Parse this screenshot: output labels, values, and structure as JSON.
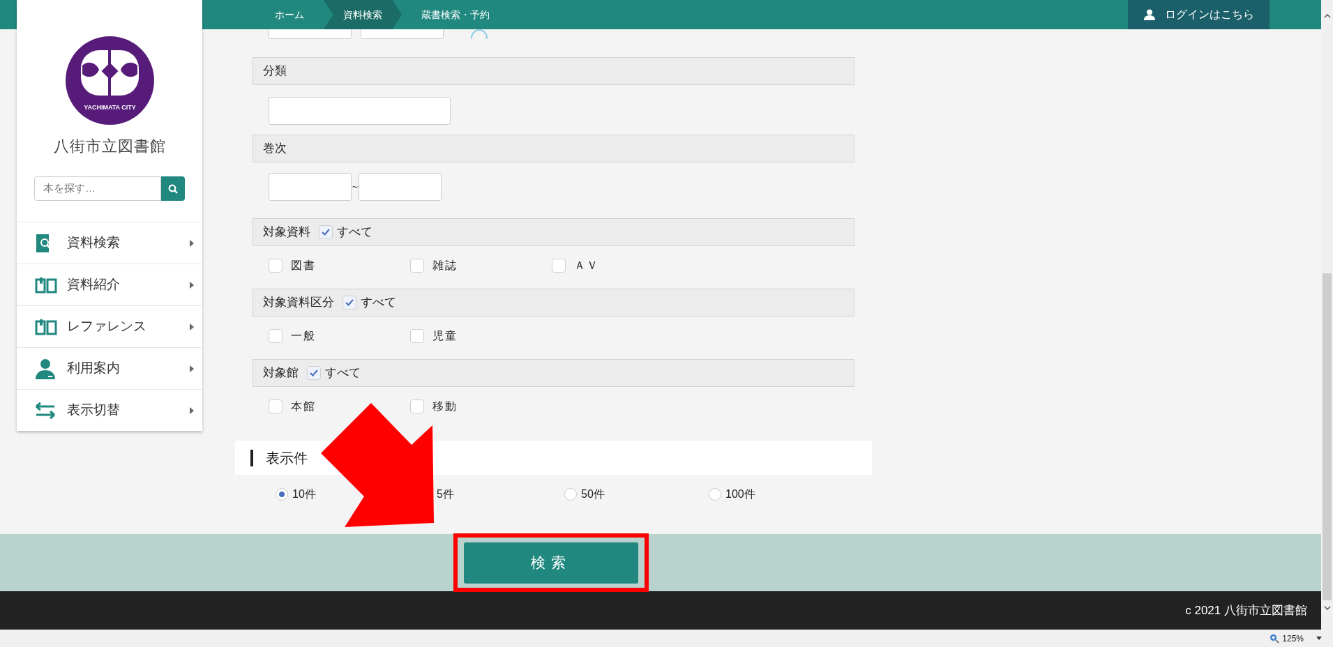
{
  "breadcrumb": [
    {
      "label": "ホーム",
      "selected": false
    },
    {
      "label": "資料検索",
      "selected": true
    },
    {
      "label": "蔵書検索・予約",
      "selected": false
    }
  ],
  "login_button": "ログインはこちら",
  "sidebar": {
    "logo_text": "YACHIMATA CITY",
    "library_name": "八街市立図書館",
    "search": {
      "placeholder": "本を探す…"
    },
    "items": [
      {
        "label": "資料検索",
        "kind": "search"
      },
      {
        "label": "資料紹介",
        "kind": "book"
      },
      {
        "label": "レファレンス",
        "kind": "book"
      },
      {
        "label": "利用案内",
        "kind": "person"
      },
      {
        "label": "表示切替",
        "kind": "swap"
      }
    ]
  },
  "form": [
    {
      "kind": "text",
      "label": "分類"
    },
    {
      "kind": "range",
      "label": "巻次",
      "separator": "~"
    },
    {
      "kind": "checks",
      "label": "対象資料",
      "all_label": "すべて",
      "all_checked": true,
      "options": [
        {
          "label": "図書",
          "checked": false
        },
        {
          "label": "雑誌",
          "checked": false
        },
        {
          "label": "ＡＶ",
          "checked": false
        }
      ]
    },
    {
      "kind": "checks",
      "label": "対象資料区分",
      "all_label": "すべて",
      "all_checked": true,
      "options": [
        {
          "label": "一般",
          "checked": false
        },
        {
          "label": "児童",
          "checked": false
        }
      ]
    },
    {
      "kind": "checks",
      "label": "対象館",
      "all_label": "すべて",
      "all_checked": true,
      "options": [
        {
          "label": "本館",
          "checked": false
        },
        {
          "label": "移動",
          "checked": false
        }
      ]
    }
  ],
  "display_count": {
    "title": "表示件",
    "options": [
      {
        "label": "10件",
        "selected": true
      },
      {
        "label": "5件"
      },
      {
        "label": "50件",
        "selected": false
      },
      {
        "label": "100件",
        "selected": false
      }
    ]
  },
  "search_button": "検索",
  "footer": "c 2021 八街市立図書館",
  "zoom": "125%"
}
